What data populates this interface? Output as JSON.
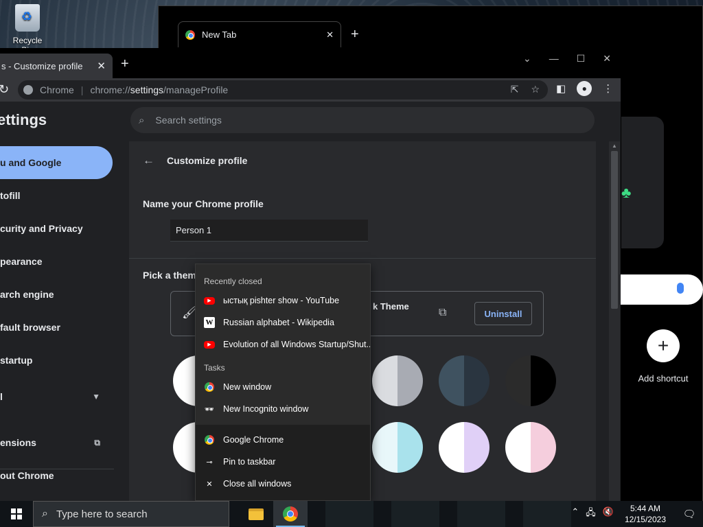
{
  "desktop": {
    "recycle_bin_label": "Recycle Bin"
  },
  "back_window": {
    "tab_title": "New Tab",
    "tab_close": "✕",
    "new_tab": "+",
    "add_shortcut_label": "Add shortcut",
    "add_shortcut_symbol": "+"
  },
  "front_window": {
    "tab_title": "s - Customize profile",
    "tab_close": "✕",
    "new_tab": "+",
    "controls": {
      "tab_search": "⌄",
      "minimize": "—",
      "maximize": "☐",
      "close": "✕"
    },
    "omnibox": {
      "site_label": "Chrome",
      "url_prefix": "chrome://",
      "url_host": "settings",
      "url_path": "/manageProfile"
    }
  },
  "settings": {
    "title": "ettings",
    "search_placeholder": "Search settings",
    "sidebar": [
      {
        "label": "u and Google",
        "active": true
      },
      {
        "label": "tofill"
      },
      {
        "label": "curity and Privacy"
      },
      {
        "label": "pearance"
      },
      {
        "label": "arch engine"
      },
      {
        "label": "fault browser"
      },
      {
        "label": "startup"
      },
      {
        "label": "l"
      },
      {
        "label": "ensions"
      },
      {
        "label": "out Chrome"
      }
    ],
    "page_heading": "Customize profile",
    "name_label": "Name your Chrome profile",
    "name_value": "Person 1",
    "pick_theme_label": "Pick a theme",
    "theme_name": "k Theme",
    "uninstall_label": "Uninstall"
  },
  "swatches": [
    {
      "left": "#ffffff",
      "right": "#ffffff"
    },
    {
      "left": "#dadce0",
      "right": "#a8abb3"
    },
    {
      "left": "#3f5260",
      "right": "#2a3540"
    },
    {
      "left": "#2b2b2b",
      "right": "#000000"
    },
    {
      "left": "#ffffff",
      "right": "#ffffff"
    },
    {
      "left": "#e8f7fa",
      "right": "#a9e2ec"
    },
    {
      "left": "#ffffff",
      "right": "#e0d0f7"
    },
    {
      "left": "#ffffff",
      "right": "#f5cedd"
    }
  ],
  "jumplist": {
    "recently_closed_heading": "Recently closed",
    "recent": [
      {
        "label": "ыстық pishter show - YouTube",
        "icon": "youtube-icon"
      },
      {
        "label": "Russian alphabet - Wikipedia",
        "icon": "wikipedia-icon"
      },
      {
        "label": "Evolution of all Windows Startup/Shut...",
        "icon": "youtube-icon"
      }
    ],
    "tasks_heading": "Tasks",
    "tasks": [
      {
        "label": "New window",
        "icon": "chrome-icon"
      },
      {
        "label": "New Incognito window",
        "icon": "incognito-icon"
      }
    ],
    "app_actions": [
      {
        "label": "Google Chrome",
        "icon": "chrome-icon"
      },
      {
        "label": "Pin to taskbar",
        "icon": "pin-icon"
      },
      {
        "label": "Close all windows",
        "icon": "close-icon"
      }
    ]
  },
  "taskbar": {
    "search_placeholder": "Type here to search",
    "time": "5:44 AM",
    "date": "12/15/2023"
  },
  "colors": {
    "accent": "#8ab4f8",
    "bg": "#202124"
  }
}
